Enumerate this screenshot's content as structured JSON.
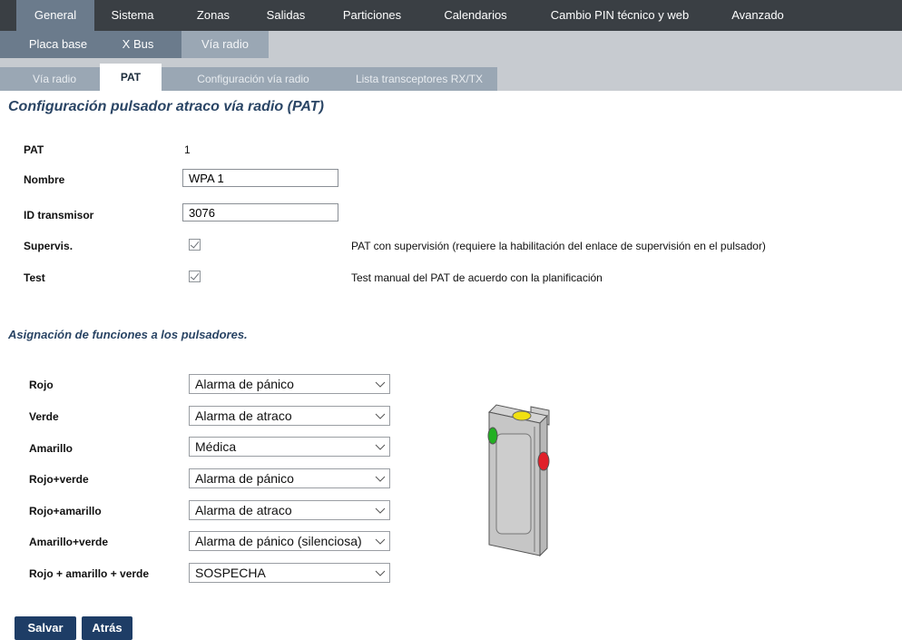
{
  "nav_primary": [
    "General",
    "Sistema",
    "Zonas",
    "Salidas",
    "Particiones",
    "Calendarios",
    "Cambio PIN técnico y web",
    "Avanzado"
  ],
  "nav_secondary": [
    "Placa base",
    "X Bus",
    "Vía radio"
  ],
  "nav_tertiary": [
    "Vía radio",
    "PAT",
    "Configuración vía radio",
    "Lista transceptores RX/TX"
  ],
  "page_title": "Configuración pulsador atraco vía radio (PAT)",
  "fields": {
    "pat": {
      "label": "PAT",
      "value": "1"
    },
    "nombre": {
      "label": "Nombre",
      "value": "WPA 1"
    },
    "id_transmisor": {
      "label": "ID transmisor",
      "value": "3076"
    },
    "supervis": {
      "label": "Supervis.",
      "checked": true,
      "description": "PAT con supervisión (requiere la habilitación del enlace de supervisión en el pulsador)"
    },
    "test": {
      "label": "Test",
      "checked": true,
      "description": "Test manual del PAT de acuerdo con la planificación"
    }
  },
  "assignment_title": "Asignación de funciones a los pulsadores.",
  "assignments": [
    {
      "label": "Rojo",
      "value": "Alarma de pánico"
    },
    {
      "label": "Verde",
      "value": "Alarma de atraco"
    },
    {
      "label": "Amarillo",
      "value": "Médica"
    },
    {
      "label": "Rojo+verde",
      "value": "Alarma de pánico"
    },
    {
      "label": "Rojo+amarillo",
      "value": "Alarma de atraco"
    },
    {
      "label": "Amarillo+verde",
      "value": "Alarma de pánico (silenciosa)"
    },
    {
      "label": "Rojo + amarillo + verde",
      "value": "SOSPECHA"
    }
  ],
  "buttons": {
    "save": "Salvar",
    "back": "Atrás"
  },
  "colors": {
    "nav_dark": "#3a3f44",
    "nav_mid": "#6b7b8c",
    "nav_light": "#9aa7b4",
    "title": "#2a4565",
    "button": "#1e3d66",
    "led_red": "#e0202a",
    "led_green": "#22b022",
    "led_yellow": "#f0e010"
  },
  "icons": {
    "select_arrow": "chevron-down-icon",
    "checkbox": "checkmark-icon"
  }
}
